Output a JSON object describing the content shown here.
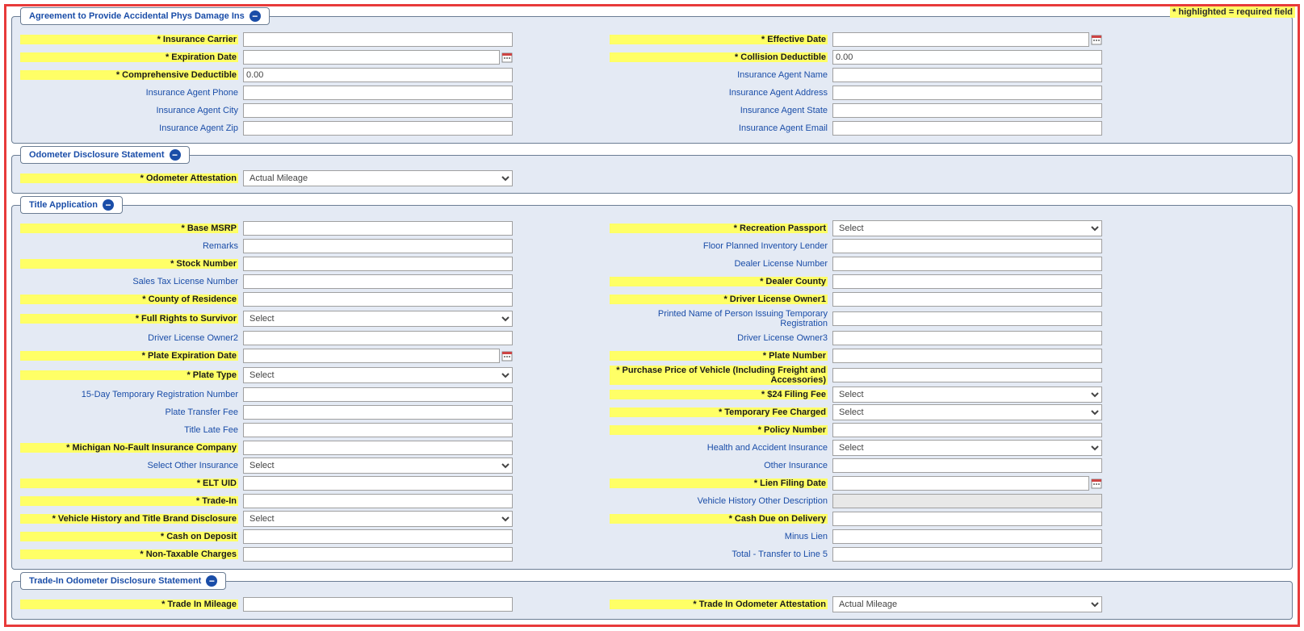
{
  "requiredNote": "* highlighted = required field",
  "panels": {
    "insurance": {
      "title": "Agreement to Provide Accidental Phys Damage Ins",
      "fields": {
        "carrier": {
          "label": "* Insurance Carrier",
          "required": true
        },
        "effDate": {
          "label": "* Effective Date",
          "required": true
        },
        "expDate": {
          "label": "* Expiration Date",
          "required": true
        },
        "collDed": {
          "label": "* Collision Deductible",
          "required": true,
          "value": "0.00"
        },
        "compDed": {
          "label": "* Comprehensive Deductible",
          "required": true,
          "value": "0.00"
        },
        "agentName": {
          "label": "Insurance Agent Name"
        },
        "agentPhone": {
          "label": "Insurance Agent Phone"
        },
        "agentAddr": {
          "label": "Insurance Agent Address"
        },
        "agentCity": {
          "label": "Insurance Agent City"
        },
        "agentState": {
          "label": "Insurance Agent State"
        },
        "agentZip": {
          "label": "Insurance Agent Zip"
        },
        "agentEmail": {
          "label": "Insurance Agent Email"
        }
      }
    },
    "odom": {
      "title": "Odometer Disclosure Statement",
      "attLabel": "* Odometer Attestation",
      "attValue": "Actual Mileage"
    },
    "title": {
      "title": "Title Application",
      "selectDefault": "Select",
      "fields": {
        "baseMsrp": {
          "label": "* Base MSRP",
          "required": true
        },
        "recPassport": {
          "label": "* Recreation Passport",
          "required": true
        },
        "remarks": {
          "label": "Remarks"
        },
        "floorLender": {
          "label": "Floor Planned Inventory Lender"
        },
        "stockNo": {
          "label": "* Stock Number",
          "required": true
        },
        "dealerLic": {
          "label": "Dealer License Number"
        },
        "salesTaxLic": {
          "label": "Sales Tax License Number"
        },
        "dealerCounty": {
          "label": "* Dealer County",
          "required": true
        },
        "countyRes": {
          "label": "* County of Residence",
          "required": true
        },
        "dlOwner1": {
          "label": "* Driver License Owner1",
          "required": true
        },
        "fullRights": {
          "label": "* Full Rights to Survivor",
          "required": true
        },
        "printedName": {
          "label": "Printed Name of Person Issuing Temporary Registration"
        },
        "dlOwner2": {
          "label": "Driver License Owner2"
        },
        "dlOwner3": {
          "label": "Driver License Owner3"
        },
        "plateExp": {
          "label": "* Plate Expiration Date",
          "required": true
        },
        "plateNo": {
          "label": "* Plate Number",
          "required": true
        },
        "plateType": {
          "label": "* Plate Type",
          "required": true
        },
        "purchPrice": {
          "label": "* Purchase Price of Vehicle (Including Freight and Accessories)",
          "required": true
        },
        "tempReg": {
          "label": "15-Day Temporary Registration Number"
        },
        "filingFee": {
          "label": "* $24 Filing Fee",
          "required": true
        },
        "plateXfer": {
          "label": "Plate Transfer Fee"
        },
        "tempFee": {
          "label": "* Temporary Fee Charged",
          "required": true
        },
        "titleLate": {
          "label": "Title Late Fee"
        },
        "policyNo": {
          "label": "* Policy Number",
          "required": true
        },
        "nofault": {
          "label": "* Michigan No-Fault Insurance Company",
          "required": true
        },
        "healthAcc": {
          "label": "Health and Accident Insurance"
        },
        "selOther": {
          "label": "Select Other Insurance"
        },
        "otherIns": {
          "label": "Other Insurance"
        },
        "eltUid": {
          "label": "* ELT UID",
          "required": true
        },
        "lienDate": {
          "label": "* Lien Filing Date",
          "required": true
        },
        "tradeIn": {
          "label": "* Trade-In",
          "required": true
        },
        "vehHistOther": {
          "label": "Vehicle History Other Description"
        },
        "vehHist": {
          "label": "* Vehicle History and Title Brand Disclosure",
          "required": true
        },
        "cashDel": {
          "label": "* Cash Due on Delivery",
          "required": true
        },
        "cashDep": {
          "label": "* Cash on Deposit",
          "required": true
        },
        "minusLien": {
          "label": "Minus Lien"
        },
        "nonTax": {
          "label": "* Non-Taxable Charges",
          "required": true
        },
        "totalXfer": {
          "label": "Total - Transfer to Line 5"
        }
      }
    },
    "tradeInOdom": {
      "title": "Trade-In Odometer Disclosure Statement",
      "miLabel": "* Trade In Mileage",
      "attLabel": "* Trade In Odometer Attestation",
      "attValue": "Actual Mileage"
    }
  }
}
